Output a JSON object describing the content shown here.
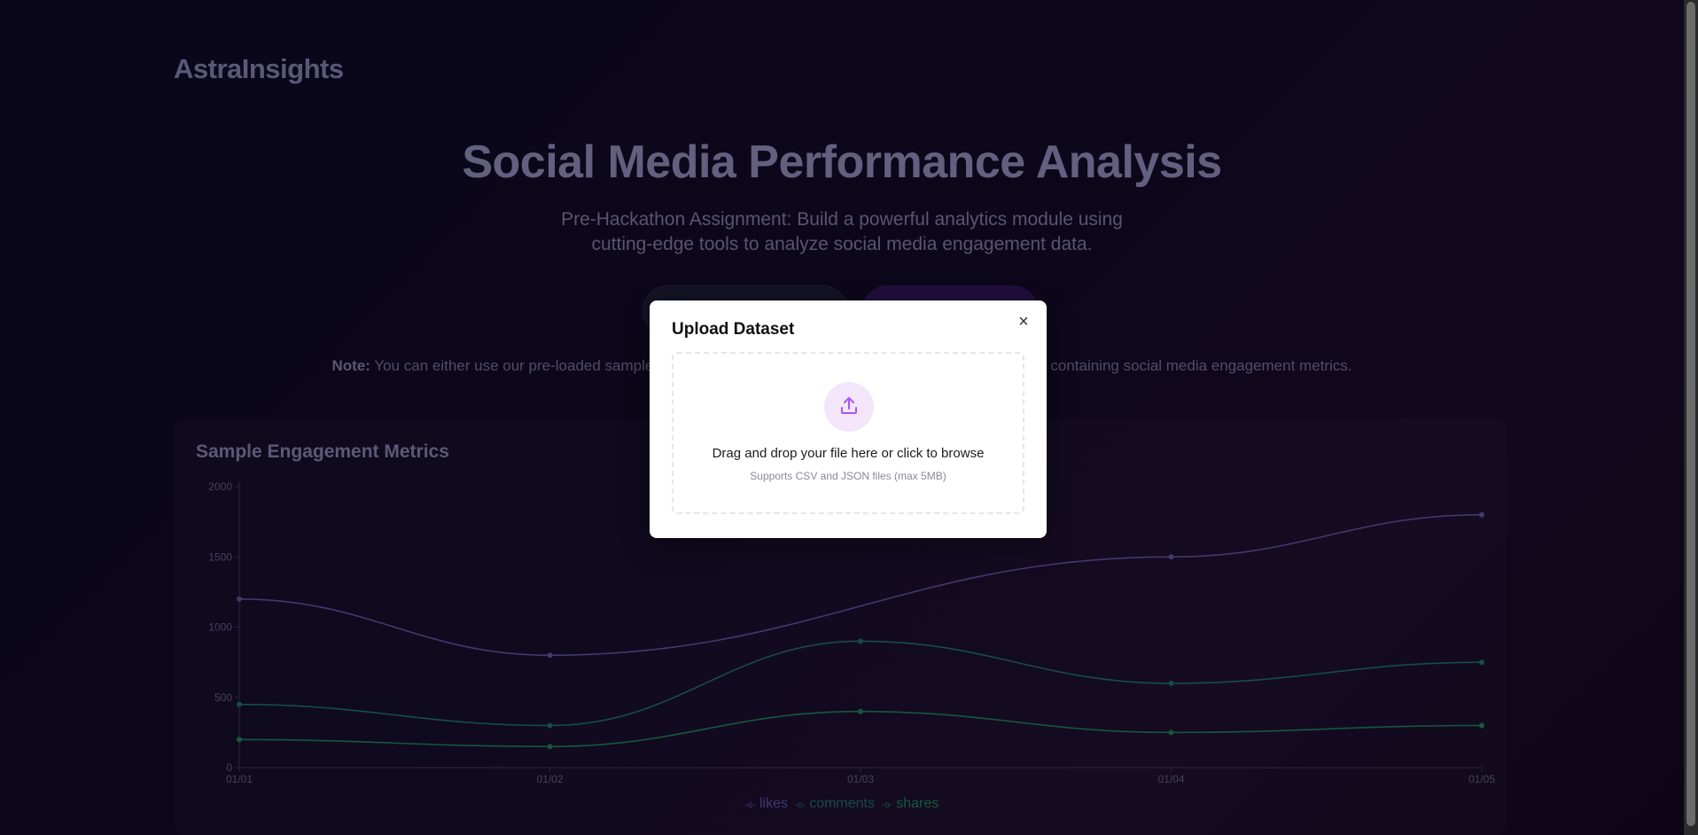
{
  "app": {
    "logo": "AstraInsights"
  },
  "hero": {
    "title": "Social Media Performance Analysis",
    "subtitle_line1": "Pre-Hackathon Assignment: Build a powerful analytics module using",
    "subtitle_line2": "cutting-edge tools to analyze social media engagement data."
  },
  "note": {
    "label": "Note:",
    "text_left": " You can either use our pre-loaded sample",
    "text_right": "containing social media engagement metrics."
  },
  "card": {
    "title": "Sample Engagement Metrics"
  },
  "chart_data": {
    "type": "line",
    "categories": [
      "01/01",
      "01/02",
      "01/03",
      "01/04",
      "01/05"
    ],
    "series": [
      {
        "name": "likes",
        "values": [
          1200,
          800,
          null,
          1500,
          1800
        ],
        "color": "#5a4f9a"
      },
      {
        "name": "comments",
        "values": [
          450,
          300,
          900,
          600,
          750
        ],
        "color": "#1f6b64"
      },
      {
        "name": "shares",
        "values": [
          200,
          150,
          400,
          250,
          300
        ],
        "color": "#1f7a55"
      }
    ],
    "y_ticks": [
      "0",
      "500",
      "1000",
      "1500",
      "2000"
    ],
    "ylim": [
      0,
      2000
    ],
    "grid": false,
    "legend_position": "bottom"
  },
  "modal": {
    "title": "Upload Dataset",
    "close_glyph": "×",
    "drop_text": "Drag and drop your file here or click to browse",
    "drop_hint": "Supports CSV and JSON files (max 5MB)"
  },
  "colors": {
    "accent": "#a855f7",
    "upload_circle_bg": "#f3e6fb"
  }
}
